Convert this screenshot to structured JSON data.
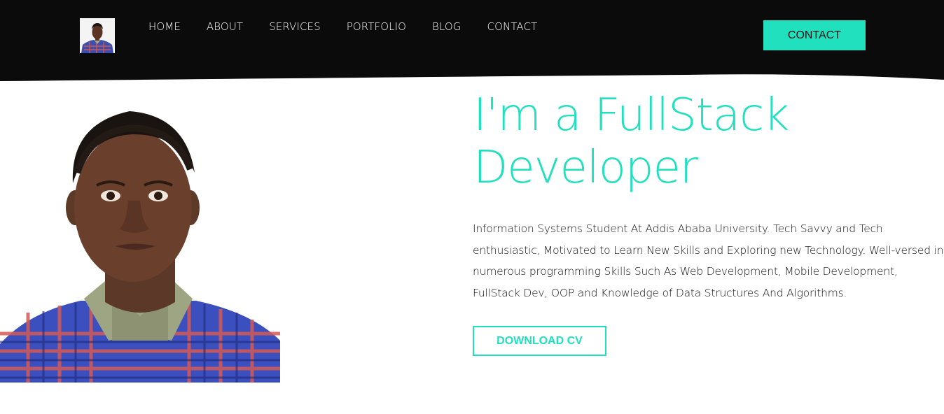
{
  "header": {
    "nav": [
      "HOME",
      "ABOUT",
      "SERVICES",
      "PORTFOLIO",
      "BLOG",
      "CONTACT"
    ],
    "cta_label": "CONTACT",
    "colors": {
      "background": "#0b0b0b",
      "accent": "#21e0be"
    }
  },
  "hero": {
    "title_line1": "I'm a FullStack",
    "title_line2": "Developer",
    "bio": "Information Systems Student At Addis Ababa University. Tech Savvy and Tech enthusiastic, Motivated to Learn New Skills and Exploring new Technology. Well-versed in numerous programming Skills Such As Web Development, Mobile Development, FullStack Dev, OOP and Knowledge of Data Structures And Algorithms.",
    "cv_button": "DOWNLOAD CV"
  }
}
